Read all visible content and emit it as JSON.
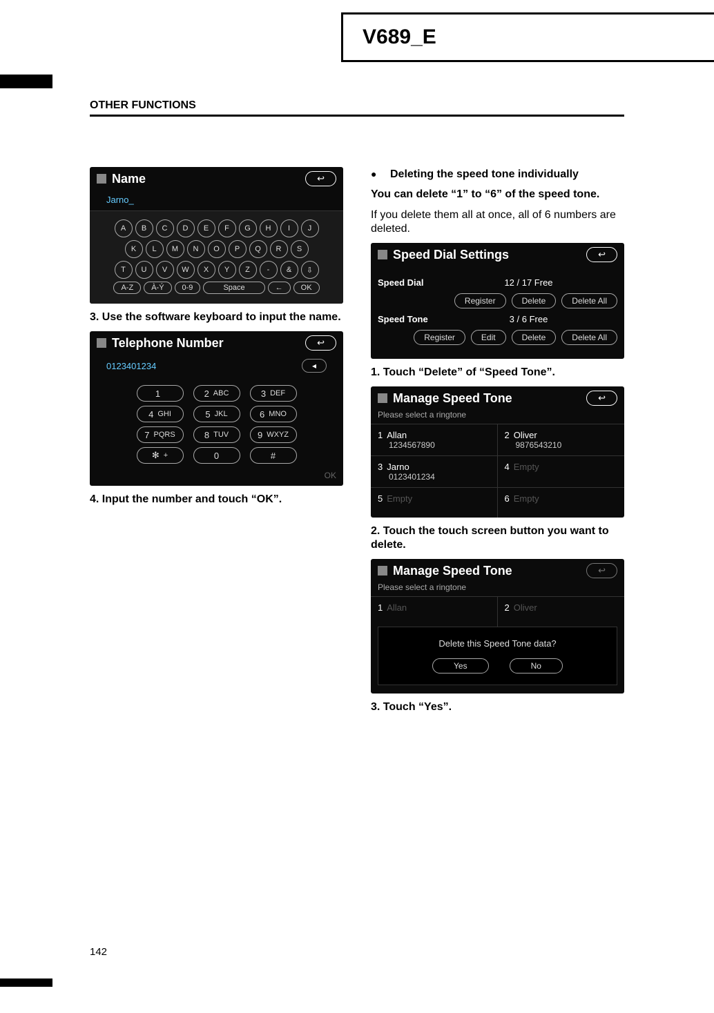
{
  "header": {
    "title": "V689_E",
    "section": "OTHER FUNCTIONS",
    "page_number": "142"
  },
  "left": {
    "shot_name": {
      "title": "Name",
      "value": "Jarno",
      "keys_row1": [
        "A",
        "B",
        "C",
        "D",
        "E",
        "F",
        "G",
        "H",
        "I",
        "J"
      ],
      "keys_row2": [
        "K",
        "L",
        "M",
        "N",
        "O",
        "P",
        "Q",
        "R",
        "S"
      ],
      "keys_row3": [
        "T",
        "U",
        "V",
        "W",
        "X",
        "Y",
        "Z",
        "-",
        "&",
        "⇩"
      ],
      "keys_row4": [
        "A-Z",
        "À-Ý",
        "0-9",
        "Space",
        "←",
        "OK"
      ]
    },
    "step3": "3.  Use the software keyboard to input the name.",
    "shot_phone": {
      "title": "Telephone Number",
      "value": "0123401234",
      "del_label": "◂",
      "rows": [
        [
          {
            "n": "1",
            "s": ""
          },
          {
            "n": "2",
            "s": "ABC"
          },
          {
            "n": "3",
            "s": "DEF"
          }
        ],
        [
          {
            "n": "4",
            "s": "GHI"
          },
          {
            "n": "5",
            "s": "JKL"
          },
          {
            "n": "6",
            "s": "MNO"
          }
        ],
        [
          {
            "n": "7",
            "s": "PQRS"
          },
          {
            "n": "8",
            "s": "TUV"
          },
          {
            "n": "9",
            "s": "WXYZ"
          }
        ],
        [
          {
            "n": "✻",
            "s": "+"
          },
          {
            "n": "0",
            "s": ""
          },
          {
            "n": "#",
            "s": ""
          }
        ]
      ],
      "ok": "OK"
    },
    "step4": "4.  Input the number and touch “OK”."
  },
  "right": {
    "bullet": "Deleting the speed tone individually",
    "p1": "You can delete “1” to “6” of the speed tone.",
    "p2": "If you delete them all at once, all of 6 numbers are deleted.",
    "shot_sd": {
      "title": "Speed Dial Settings",
      "dial_label": "Speed Dial",
      "dial_free": "12 / 17  Free",
      "dial_btns": [
        "Register",
        "Delete",
        "Delete All"
      ],
      "tone_label": "Speed Tone",
      "tone_free": "3 / 6  Free",
      "tone_btns": [
        "Register",
        "Edit",
        "Delete",
        "Delete All"
      ]
    },
    "step1": "1.  Touch “Delete” of “Speed Tone”.",
    "shot_manage": {
      "title": "Manage Speed Tone",
      "sub": "Please select a ringtone",
      "cells": [
        {
          "idx": "1",
          "name": "Allan",
          "num": "1234567890",
          "disabled": false
        },
        {
          "idx": "2",
          "name": "Oliver",
          "num": "9876543210",
          "disabled": false
        },
        {
          "idx": "3",
          "name": "Jarno",
          "num": "0123401234",
          "disabled": false
        },
        {
          "idx": "4",
          "name": "Empty",
          "num": "",
          "disabled": true
        },
        {
          "idx": "5",
          "name": "Empty",
          "num": "",
          "disabled": true
        },
        {
          "idx": "6",
          "name": "Empty",
          "num": "",
          "disabled": true
        }
      ]
    },
    "step2": "2.  Touch the touch screen button you want to delete.",
    "shot_confirm": {
      "title": "Manage Speed Tone",
      "sub": "Please select a ringtone",
      "ghost1": {
        "idx": "1",
        "name": "Allan"
      },
      "ghost2": {
        "idx": "2",
        "name": "Oliver"
      },
      "msg": "Delete this Speed Tone data?",
      "yes": "Yes",
      "no": "No"
    },
    "step3": "3.  Touch “Yes”."
  },
  "icons": {
    "back": "↩"
  }
}
